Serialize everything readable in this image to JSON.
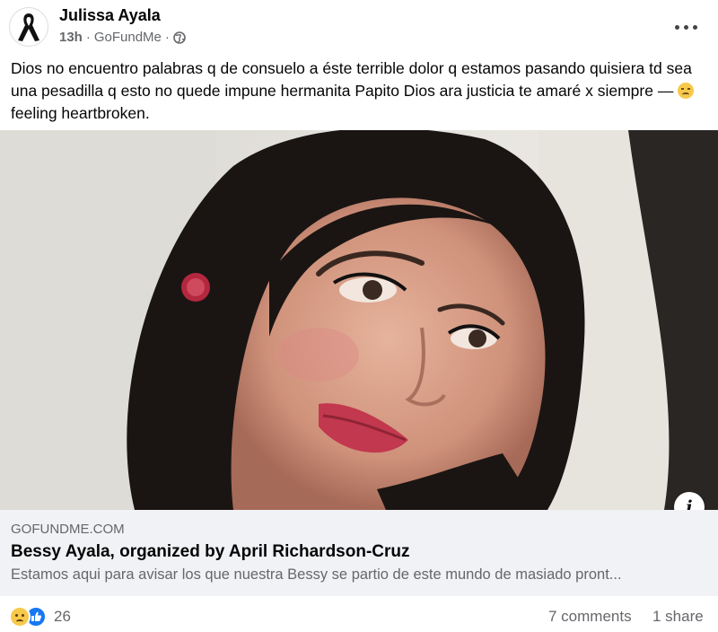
{
  "post": {
    "author": "Julissa Ayala",
    "time": "13h",
    "via": "GoFundMe",
    "separator": "·",
    "audience_icon": "globe-icon",
    "text": "Dios no encuentro palabras q de consuelo a éste terrible dolor q estamos pasando quisiera td sea una pesadilla q esto no quede impune hermanita Papito Dios ara justicia te amaré x siempre — ",
    "feeling": "feeling heartbroken."
  },
  "link": {
    "domain": "GOFUNDME.COM",
    "title": "Bessy Ayala, organized by April Richardson-Cruz",
    "description": "Estamos aqui para avisar los que nuestra Bessy se partio de este mundo de masiado pront..."
  },
  "footer": {
    "reaction_count": "26",
    "comments": "7 comments",
    "shares": "1 share"
  },
  "icons": {
    "avatar": "mourning-ribbon-icon",
    "more": "more-options-icon",
    "info": "info-icon",
    "reactions": [
      "sad-reaction-icon",
      "like-reaction-icon"
    ]
  },
  "colors": {
    "secondary_text": "#65676b",
    "link_card_bg": "#f0f2f5",
    "like_blue": "#1877f2"
  }
}
